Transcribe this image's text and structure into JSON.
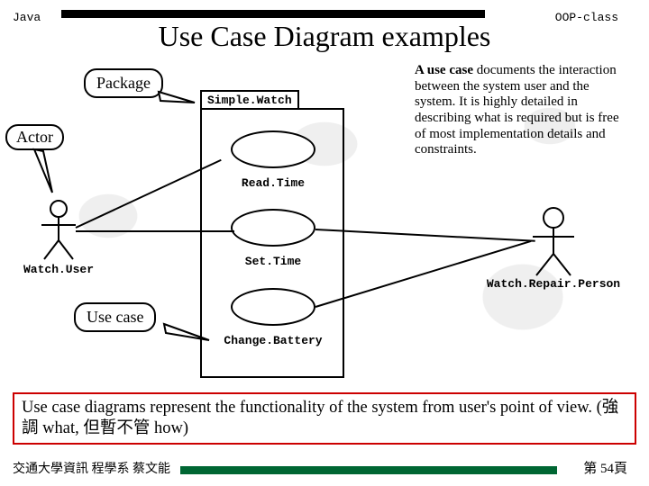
{
  "header": {
    "left": "Java",
    "right": "OOP-class"
  },
  "title": "Use Case Diagram examples",
  "labels": {
    "package": "Package",
    "actor": "Actor",
    "usecase": "Use case"
  },
  "package": {
    "tab": "Simple.Watch"
  },
  "usecases": {
    "read": "Read.Time",
    "set": "Set.Time",
    "change": "Change.Battery"
  },
  "actors": {
    "left": "Watch.User",
    "right": "Watch.Repair.Person"
  },
  "paragraph_lead": "A use case",
  "paragraph_rest": " documents the interaction between the system user and the system. It is highly detailed in describing what is required but is free of most implementation details and constraints.",
  "summary": "Use case diagrams represent the functionality of the system from user's point of view. (強調 what, 但暫不管 how)",
  "footer": {
    "left": "交通大學資訊 程學系 蔡文能",
    "right": "第 54頁"
  }
}
